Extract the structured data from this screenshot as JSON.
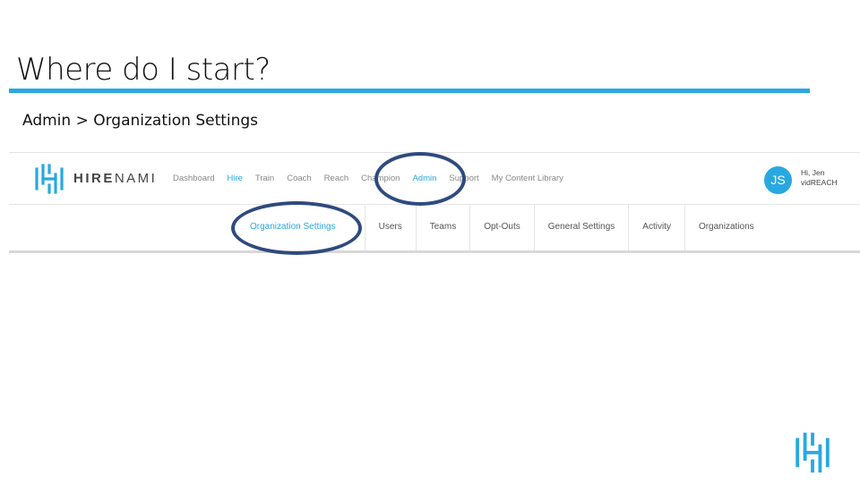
{
  "slide": {
    "title": "Where do I start?",
    "breadcrumb": "Admin > Organization Settings"
  },
  "app": {
    "brand_bold": "HIRE",
    "brand_light": "NAMI",
    "nav": [
      "Dashboard",
      "Hire",
      "Train",
      "Coach",
      "Reach",
      "Champion",
      "Admin",
      "Support",
      "My Content Library"
    ],
    "nav_active": "Hire",
    "avatar_initials": "JS",
    "greeting": "Hi, Jen",
    "account": "vidREACH",
    "subnav": [
      "Organization Settings",
      "Users",
      "Teams",
      "Opt-Outs",
      "General Settings",
      "Activity",
      "Organizations"
    ]
  },
  "colors": {
    "accent": "#29a8e0",
    "highlight_circle": "#2f4a7f"
  }
}
